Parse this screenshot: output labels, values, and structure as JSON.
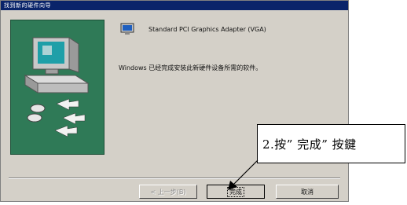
{
  "window": {
    "title": "找到新的硬件向导"
  },
  "device": {
    "name": "Standard PCI Graphics Adapter (VGA)"
  },
  "message": "Windows 已经完成安装此新硬件设备所需的软件。",
  "buttons": {
    "back_label": "< 上一步(B)",
    "finish_label": "完成",
    "cancel_label": "取消"
  },
  "annotation": {
    "text": "2.按” 完成” 按鍵"
  },
  "colors": {
    "titlebar": "#0a246a",
    "dialog_bg": "#d4d0c8",
    "art_bg": "#2f7a57"
  }
}
